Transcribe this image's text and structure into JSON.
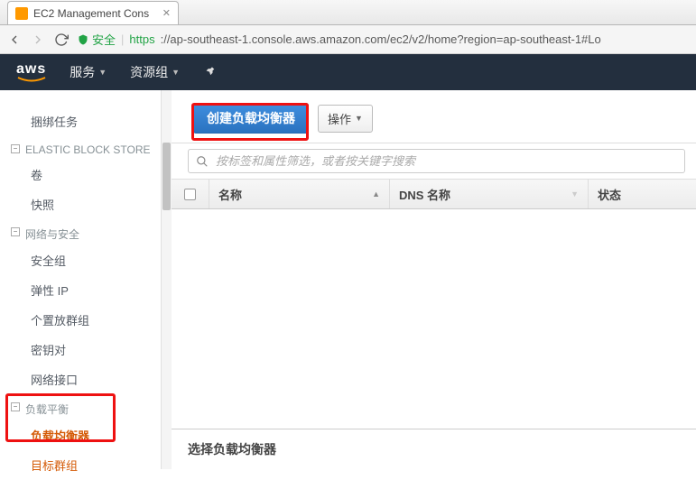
{
  "browser": {
    "tab_title": "EC2 Management Cons",
    "secure_label": "安全",
    "url_scheme": "https",
    "url_rest": "://ap-southeast-1.console.aws.amazon.com/ec2/v2/home?region=ap-southeast-1#Lo"
  },
  "aws_nav": {
    "logo": "aws",
    "services": "服务",
    "resource_groups": "资源组"
  },
  "sidebar": {
    "item_bundle_tasks": "捆绑任务",
    "section_ebs": "ELASTIC BLOCK STORE",
    "item_volumes": "卷",
    "item_snapshots": "快照",
    "section_netsec": "网络与安全",
    "item_security_groups": "安全组",
    "item_elastic_ips": "弹性 IP",
    "item_placement_groups": "个置放群组",
    "item_key_pairs": "密钥对",
    "item_network_interfaces": "网络接口",
    "section_lb": "负载平衡",
    "item_load_balancers": "负载均衡器",
    "item_target_groups": "目标群组"
  },
  "toolbar": {
    "create_lb": "创建负载均衡器",
    "actions": "操作"
  },
  "filter": {
    "placeholder": "按标签和属性筛选，或者按关键字搜索"
  },
  "table": {
    "col_name": "名称",
    "col_dns": "DNS 名称",
    "col_status": "状态"
  },
  "detail": {
    "prompt": "选择负载均衡器"
  }
}
